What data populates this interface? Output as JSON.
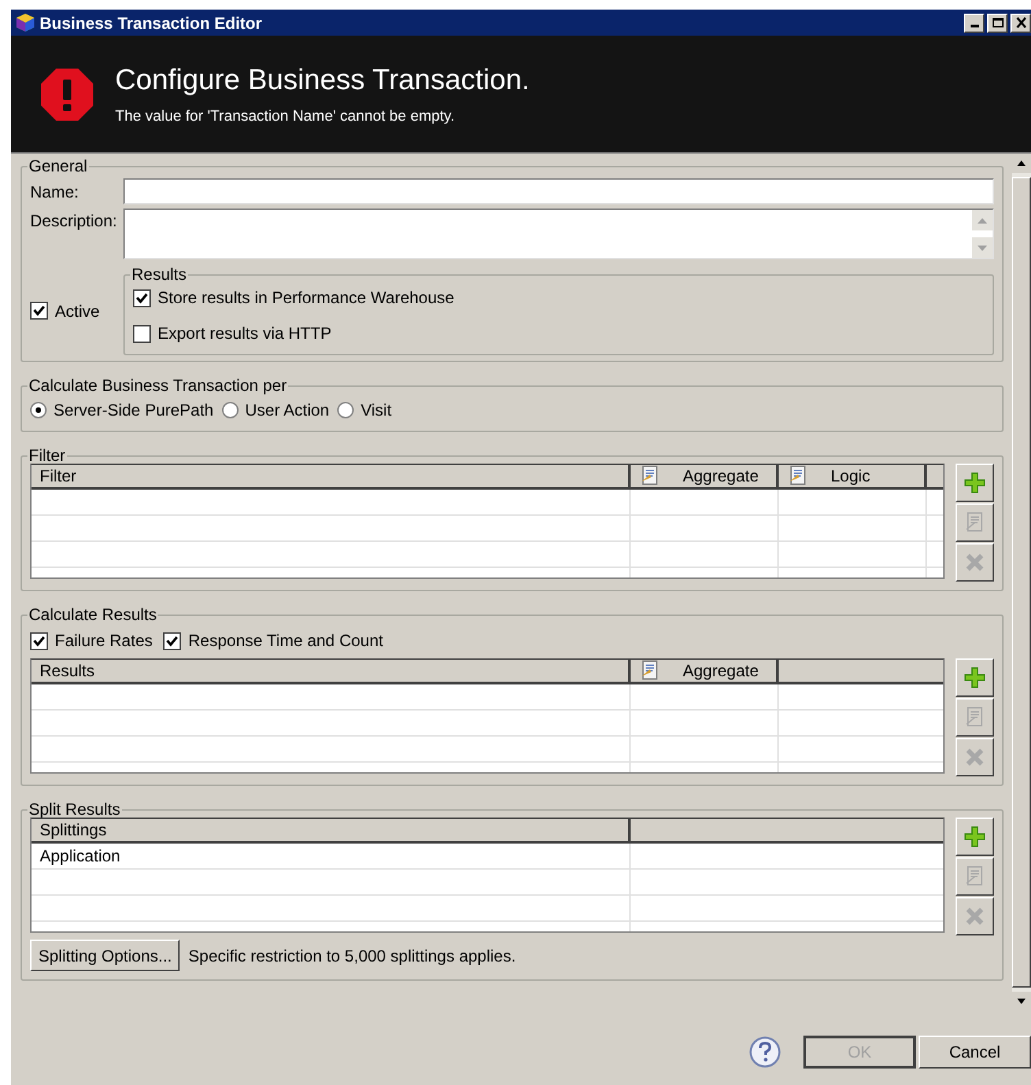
{
  "window": {
    "title": "Business Transaction Editor"
  },
  "header": {
    "title": "Configure Business Transaction.",
    "message": "The value for 'Transaction Name' cannot be empty."
  },
  "general": {
    "legend": "General",
    "name_label": "Name:",
    "description_label": "Description:",
    "active": {
      "label": "Active",
      "checked": true
    },
    "results": {
      "legend": "Results",
      "options": [
        {
          "label": "Store results in Performance Warehouse",
          "checked": true
        },
        {
          "label": "Export results via HTTP",
          "checked": false
        }
      ]
    }
  },
  "calculate_per": {
    "legend": "Calculate Business Transaction per",
    "options": [
      {
        "label": "Server-Side PurePath",
        "selected": true
      },
      {
        "label": "User Action",
        "selected": false
      },
      {
        "label": "Visit",
        "selected": false
      }
    ]
  },
  "filter": {
    "legend": "Filter",
    "columns": [
      {
        "label": "Filter",
        "icon": false
      },
      {
        "label": "Aggregate",
        "icon": true
      },
      {
        "label": "Logic",
        "icon": true
      }
    ],
    "buttons": [
      {
        "kind": "add",
        "disabled": false
      },
      {
        "kind": "edit",
        "disabled": true
      },
      {
        "kind": "remove",
        "disabled": true
      }
    ]
  },
  "calculate_results": {
    "legend": "Calculate Results",
    "options": [
      {
        "label": "Failure Rates",
        "checked": true
      },
      {
        "label": "Response Time and Count",
        "checked": true
      }
    ],
    "columns": [
      {
        "label": "Results",
        "icon": false
      },
      {
        "label": "Aggregate",
        "icon": true
      }
    ],
    "buttons": [
      {
        "kind": "add",
        "disabled": false
      },
      {
        "kind": "edit",
        "disabled": true
      },
      {
        "kind": "remove",
        "disabled": true
      }
    ]
  },
  "split_results": {
    "legend": "Split Results",
    "columns": [
      {
        "label": "Splittings",
        "icon": false
      }
    ],
    "rows": [
      [
        "Application"
      ]
    ],
    "buttons": [
      {
        "kind": "add",
        "disabled": false
      },
      {
        "kind": "edit",
        "disabled": true
      },
      {
        "kind": "remove",
        "disabled": true
      }
    ],
    "options_button": "Splitting Options...",
    "note": "Specific restriction to 5,000 splittings applies."
  },
  "footer": {
    "buttons": [
      {
        "label": "OK",
        "disabled": true
      },
      {
        "label": "Cancel",
        "disabled": false
      }
    ]
  }
}
